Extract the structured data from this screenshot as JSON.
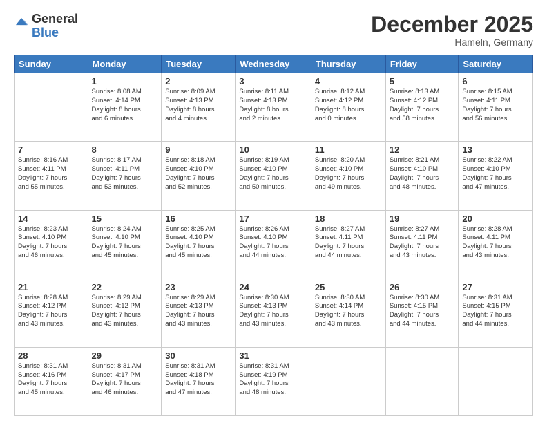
{
  "header": {
    "logo": {
      "general": "General",
      "blue": "Blue"
    },
    "month": "December 2025",
    "location": "Hameln, Germany"
  },
  "weekdays": [
    "Sunday",
    "Monday",
    "Tuesday",
    "Wednesday",
    "Thursday",
    "Friday",
    "Saturday"
  ],
  "weeks": [
    [
      {
        "day": "",
        "info": ""
      },
      {
        "day": "1",
        "info": "Sunrise: 8:08 AM\nSunset: 4:14 PM\nDaylight: 8 hours\nand 6 minutes."
      },
      {
        "day": "2",
        "info": "Sunrise: 8:09 AM\nSunset: 4:13 PM\nDaylight: 8 hours\nand 4 minutes."
      },
      {
        "day": "3",
        "info": "Sunrise: 8:11 AM\nSunset: 4:13 PM\nDaylight: 8 hours\nand 2 minutes."
      },
      {
        "day": "4",
        "info": "Sunrise: 8:12 AM\nSunset: 4:12 PM\nDaylight: 8 hours\nand 0 minutes."
      },
      {
        "day": "5",
        "info": "Sunrise: 8:13 AM\nSunset: 4:12 PM\nDaylight: 7 hours\nand 58 minutes."
      },
      {
        "day": "6",
        "info": "Sunrise: 8:15 AM\nSunset: 4:11 PM\nDaylight: 7 hours\nand 56 minutes."
      }
    ],
    [
      {
        "day": "7",
        "info": "Sunrise: 8:16 AM\nSunset: 4:11 PM\nDaylight: 7 hours\nand 55 minutes."
      },
      {
        "day": "8",
        "info": "Sunrise: 8:17 AM\nSunset: 4:11 PM\nDaylight: 7 hours\nand 53 minutes."
      },
      {
        "day": "9",
        "info": "Sunrise: 8:18 AM\nSunset: 4:10 PM\nDaylight: 7 hours\nand 52 minutes."
      },
      {
        "day": "10",
        "info": "Sunrise: 8:19 AM\nSunset: 4:10 PM\nDaylight: 7 hours\nand 50 minutes."
      },
      {
        "day": "11",
        "info": "Sunrise: 8:20 AM\nSunset: 4:10 PM\nDaylight: 7 hours\nand 49 minutes."
      },
      {
        "day": "12",
        "info": "Sunrise: 8:21 AM\nSunset: 4:10 PM\nDaylight: 7 hours\nand 48 minutes."
      },
      {
        "day": "13",
        "info": "Sunrise: 8:22 AM\nSunset: 4:10 PM\nDaylight: 7 hours\nand 47 minutes."
      }
    ],
    [
      {
        "day": "14",
        "info": "Sunrise: 8:23 AM\nSunset: 4:10 PM\nDaylight: 7 hours\nand 46 minutes."
      },
      {
        "day": "15",
        "info": "Sunrise: 8:24 AM\nSunset: 4:10 PM\nDaylight: 7 hours\nand 45 minutes."
      },
      {
        "day": "16",
        "info": "Sunrise: 8:25 AM\nSunset: 4:10 PM\nDaylight: 7 hours\nand 45 minutes."
      },
      {
        "day": "17",
        "info": "Sunrise: 8:26 AM\nSunset: 4:10 PM\nDaylight: 7 hours\nand 44 minutes."
      },
      {
        "day": "18",
        "info": "Sunrise: 8:27 AM\nSunset: 4:11 PM\nDaylight: 7 hours\nand 44 minutes."
      },
      {
        "day": "19",
        "info": "Sunrise: 8:27 AM\nSunset: 4:11 PM\nDaylight: 7 hours\nand 43 minutes."
      },
      {
        "day": "20",
        "info": "Sunrise: 8:28 AM\nSunset: 4:11 PM\nDaylight: 7 hours\nand 43 minutes."
      }
    ],
    [
      {
        "day": "21",
        "info": "Sunrise: 8:28 AM\nSunset: 4:12 PM\nDaylight: 7 hours\nand 43 minutes."
      },
      {
        "day": "22",
        "info": "Sunrise: 8:29 AM\nSunset: 4:12 PM\nDaylight: 7 hours\nand 43 minutes."
      },
      {
        "day": "23",
        "info": "Sunrise: 8:29 AM\nSunset: 4:13 PM\nDaylight: 7 hours\nand 43 minutes."
      },
      {
        "day": "24",
        "info": "Sunrise: 8:30 AM\nSunset: 4:13 PM\nDaylight: 7 hours\nand 43 minutes."
      },
      {
        "day": "25",
        "info": "Sunrise: 8:30 AM\nSunset: 4:14 PM\nDaylight: 7 hours\nand 43 minutes."
      },
      {
        "day": "26",
        "info": "Sunrise: 8:30 AM\nSunset: 4:15 PM\nDaylight: 7 hours\nand 44 minutes."
      },
      {
        "day": "27",
        "info": "Sunrise: 8:31 AM\nSunset: 4:15 PM\nDaylight: 7 hours\nand 44 minutes."
      }
    ],
    [
      {
        "day": "28",
        "info": "Sunrise: 8:31 AM\nSunset: 4:16 PM\nDaylight: 7 hours\nand 45 minutes."
      },
      {
        "day": "29",
        "info": "Sunrise: 8:31 AM\nSunset: 4:17 PM\nDaylight: 7 hours\nand 46 minutes."
      },
      {
        "day": "30",
        "info": "Sunrise: 8:31 AM\nSunset: 4:18 PM\nDaylight: 7 hours\nand 47 minutes."
      },
      {
        "day": "31",
        "info": "Sunrise: 8:31 AM\nSunset: 4:19 PM\nDaylight: 7 hours\nand 48 minutes."
      },
      {
        "day": "",
        "info": ""
      },
      {
        "day": "",
        "info": ""
      },
      {
        "day": "",
        "info": ""
      }
    ]
  ]
}
